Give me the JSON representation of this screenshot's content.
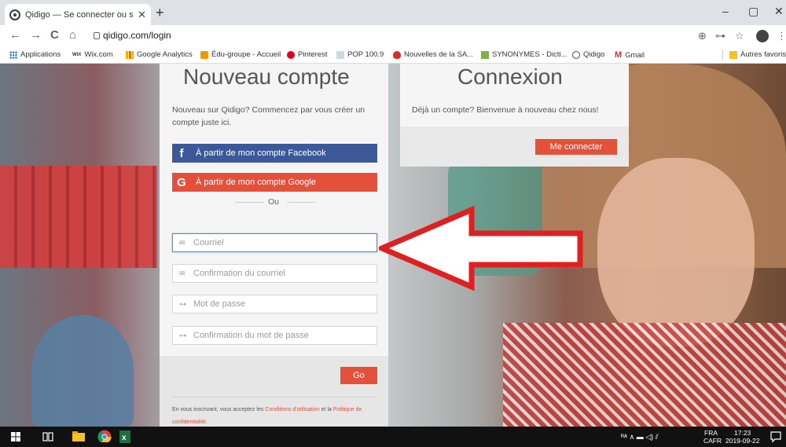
{
  "browser": {
    "tab_title": "Qidigo — Se connecter ou s'insc",
    "tab_close": "✕",
    "new_tab": "+",
    "url": "qidigo.com/login",
    "window": {
      "minimize": "–",
      "maximize": "▢",
      "close": "✕"
    },
    "nav": {
      "back": "←",
      "forward": "→",
      "reload": "C",
      "home": "⌂"
    },
    "toolbar_right": {
      "location": "⊕",
      "key": "⊶",
      "star": "☆",
      "menu": "⋮"
    },
    "bookmarks": [
      {
        "label": "Applications",
        "color": "#1a73e8"
      },
      {
        "label": "Wix.com",
        "prefix": "WIX",
        "color": "#000000"
      },
      {
        "label": "Google Analytics",
        "color": "#f9ab00"
      },
      {
        "label": "Édu-groupe - Accueil",
        "color": "#f29900"
      },
      {
        "label": "Pinterest",
        "color": "#e60023"
      },
      {
        "label": "POP 100.9",
        "color": "#cfd8dc"
      },
      {
        "label": "Nouvelles de la SA...",
        "color": "#d93025"
      },
      {
        "label": "SYNONYMES - Dicti...",
        "color": "#7cb342"
      },
      {
        "label": "Qidigo",
        "color": "#444444"
      },
      {
        "label": "Gmail",
        "prefix": "M",
        "color": "#d93025"
      }
    ],
    "other_bookmarks": "Autres favoris"
  },
  "signup": {
    "title": "Nouveau compte",
    "intro": "Nouveau sur Qidigo? Commencez par vous créer un compte juste ici.",
    "facebook_label": "À partir de mon compte Facebook",
    "google_label": "À partir de mon compte Google",
    "or": "Ou",
    "email_placeholder": "Courriel",
    "email_confirm_placeholder": "Confirmation du courriel",
    "password_placeholder": "Mot de passe",
    "password_confirm_placeholder": "Confirmation du mot de passe",
    "go": "Go",
    "legal_prefix": "En vous inscrivant, vous acceptez les ",
    "legal_terms": "Conditions d'utilisation",
    "legal_and": " et la ",
    "legal_privacy": "Politique de confidentialité",
    "legal_end": "."
  },
  "login": {
    "title": "Connexion",
    "intro": "Déjà un compte? Bienvenue à nouveau chez nous!",
    "button": "Me connecter"
  },
  "taskbar": {
    "lang": "FRA",
    "locale": "CAFR",
    "time": "17:23",
    "date": "2019-09-22",
    "tray_glyphs": "ᴿᴬ  ∧  ▬  ◁)  ⫽"
  },
  "colors": {
    "accent": "#e4503a",
    "facebook": "#3b5998",
    "arrow": "#e02020",
    "focus_border": "#5b8db3"
  }
}
